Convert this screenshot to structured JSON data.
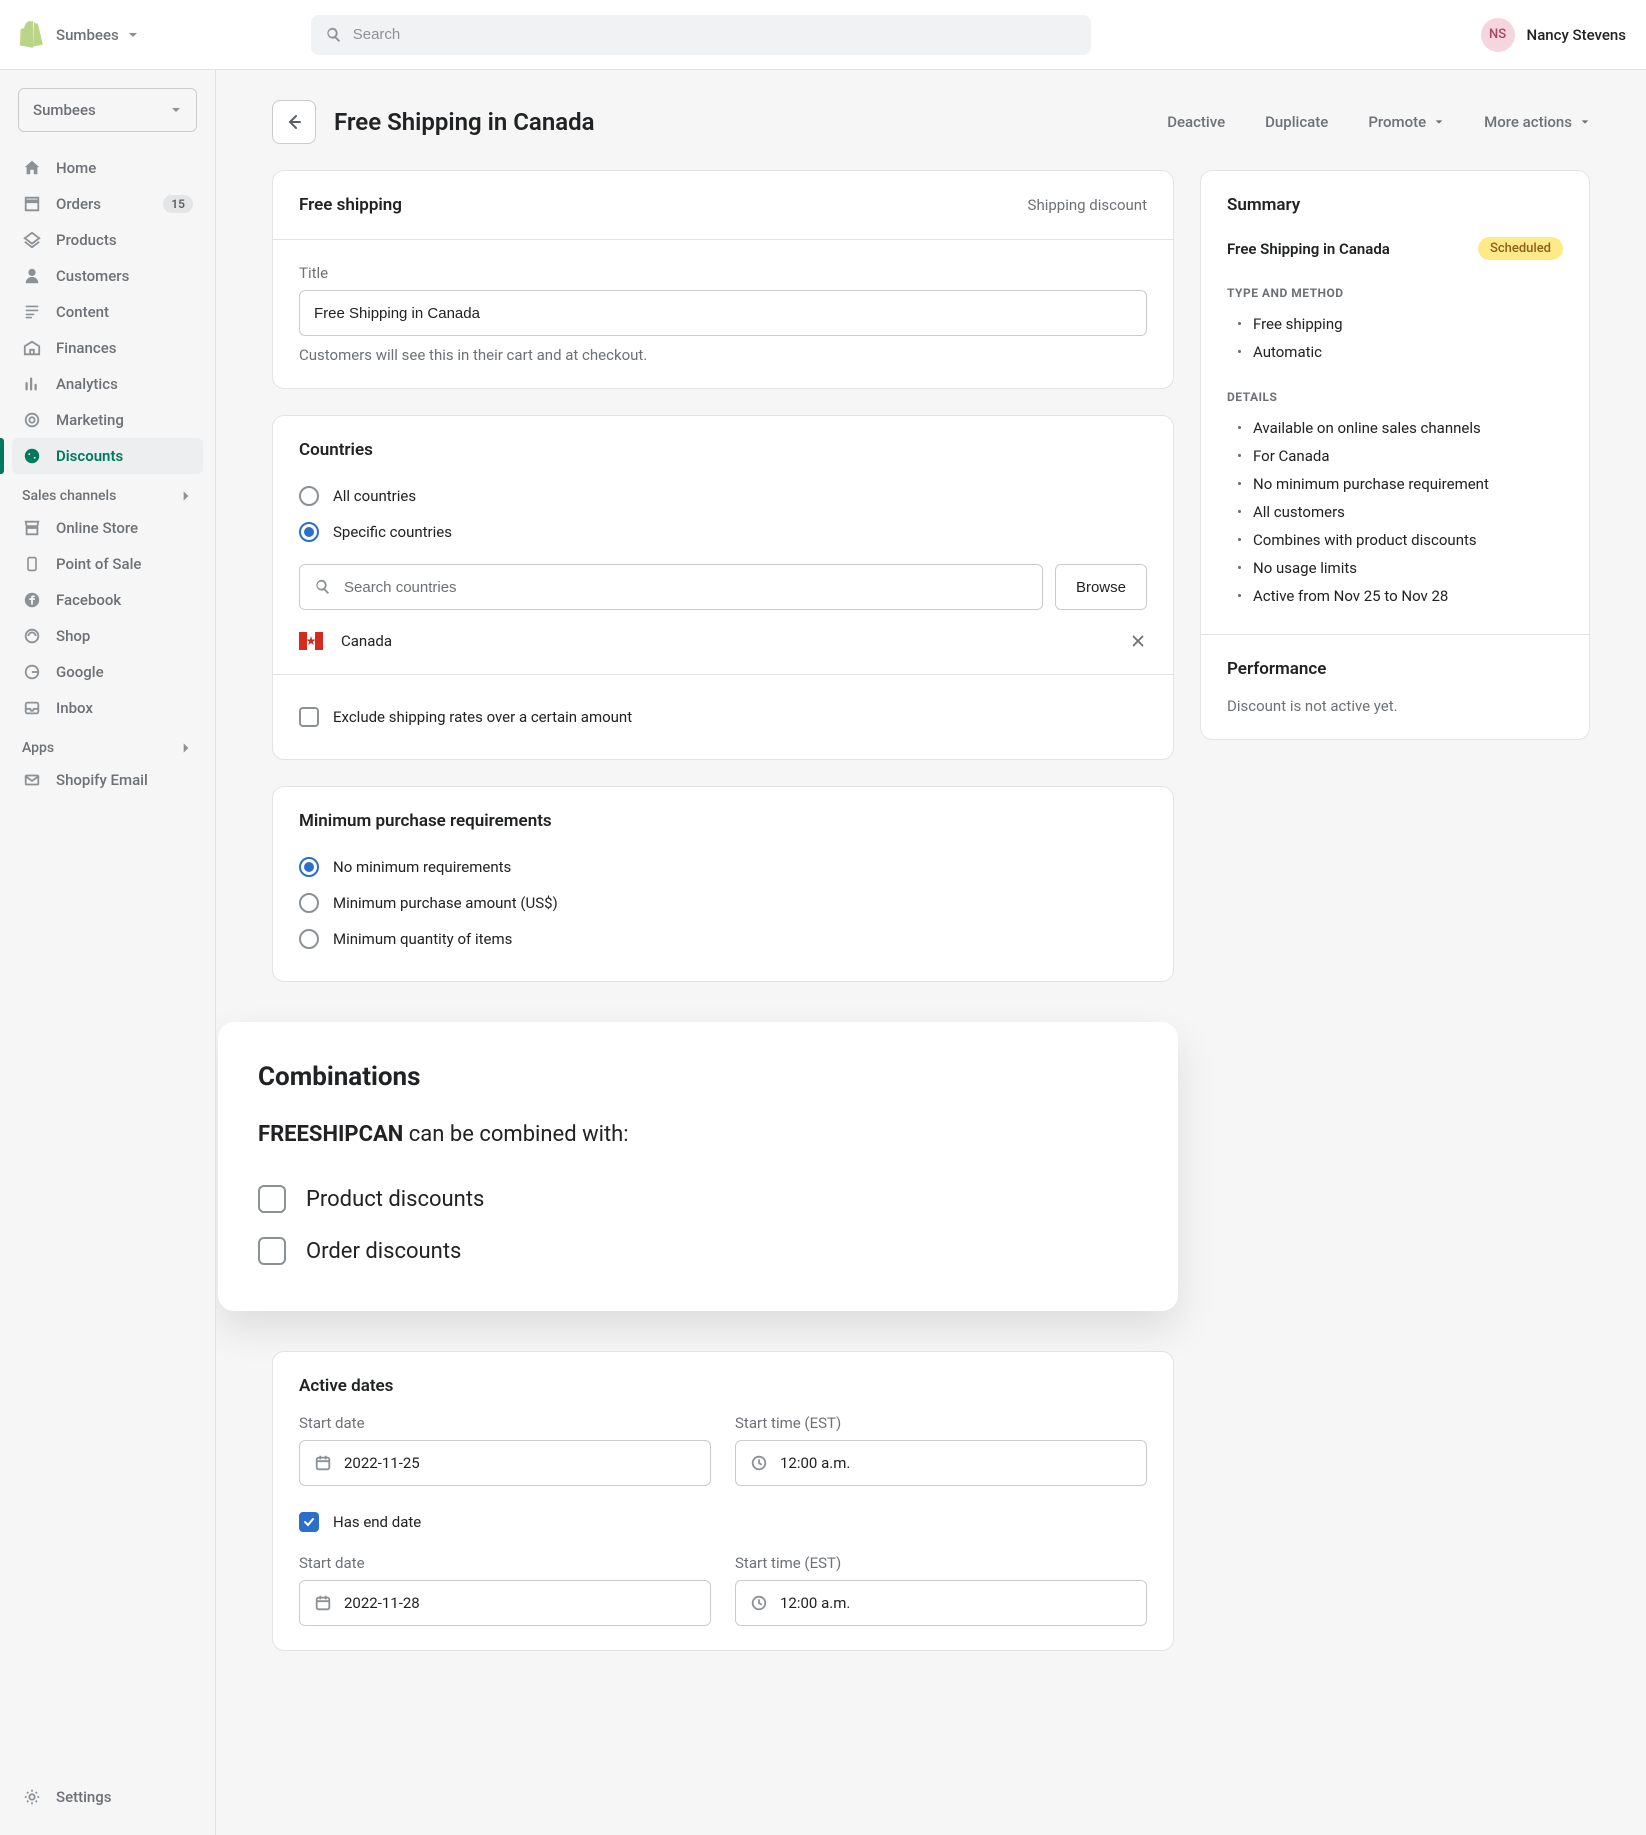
{
  "top": {
    "store_name": "Sumbees",
    "search_placeholder": "Search",
    "user_initials": "NS",
    "user_name": "Nancy Stevens"
  },
  "sidebar": {
    "store_select": "Sumbees",
    "items": [
      {
        "label": "Home",
        "icon": "home"
      },
      {
        "label": "Orders",
        "icon": "orders",
        "badge": "15"
      },
      {
        "label": "Products",
        "icon": "products"
      },
      {
        "label": "Customers",
        "icon": "customers"
      },
      {
        "label": "Content",
        "icon": "content"
      },
      {
        "label": "Finances",
        "icon": "finances"
      },
      {
        "label": "Analytics",
        "icon": "analytics"
      },
      {
        "label": "Marketing",
        "icon": "marketing"
      },
      {
        "label": "Discounts",
        "icon": "discounts",
        "active": true
      }
    ],
    "section_channels": "Sales channels",
    "channels": [
      {
        "label": "Online Store",
        "icon": "store"
      },
      {
        "label": "Point of Sale",
        "icon": "pos"
      },
      {
        "label": "Facebook",
        "icon": "fb"
      },
      {
        "label": "Shop",
        "icon": "shop"
      },
      {
        "label": "Google",
        "icon": "google"
      },
      {
        "label": "Inbox",
        "icon": "inbox"
      }
    ],
    "section_apps": "Apps",
    "apps": [
      {
        "label": "Shopify Email",
        "icon": "email"
      }
    ],
    "settings": "Settings"
  },
  "page": {
    "title": "Free Shipping in Canada",
    "actions": {
      "deactive": "Deactive",
      "duplicate": "Duplicate",
      "promote": "Promote",
      "more": "More actions"
    }
  },
  "free_shipping_card": {
    "title": "Free shipping",
    "sublabel": "Shipping discount",
    "title_label": "Title",
    "title_value": "Free Shipping in Canada",
    "title_help": "Customers will see this in their cart and at checkout."
  },
  "countries_card": {
    "title": "Countries",
    "opt_all": "All countries",
    "opt_specific": "Specific countries",
    "search_placeholder": "Search countries",
    "browse": "Browse",
    "country": "Canada",
    "exclude_label": "Exclude shipping rates over a certain amount"
  },
  "min_req_card": {
    "title": "Minimum purchase requirements",
    "opt_none": "No minimum requirements",
    "opt_amount": "Minimum purchase amount (US$)",
    "opt_qty": "Minimum quantity of items"
  },
  "combos": {
    "title": "Combinations",
    "code": "FREESHIPCAN",
    "subtext": " can be combined with:",
    "opt_product": "Product discounts",
    "opt_order": "Order discounts"
  },
  "dates": {
    "title": "Active dates",
    "start_date_label": "Start date",
    "start_time_label": "Start time (EST)",
    "start_date": "2022-11-25",
    "start_time": "12:00 a.m.",
    "has_end": "Has end date",
    "end_date_label": "Start date",
    "end_time_label": "Start time (EST)",
    "end_date": "2022-11-28",
    "end_time": "12:00 a.m."
  },
  "summary": {
    "title": "Summary",
    "name": "Free Shipping in Canada",
    "status": "Scheduled",
    "heading_type": "TYPE AND METHOD",
    "type_list": [
      "Free shipping",
      "Automatic"
    ],
    "heading_details": "DETAILS",
    "details_list": [
      "Available on online sales channels",
      "For Canada",
      "No minimum purchase requirement",
      "All customers",
      "Combines with product discounts",
      "No usage limits",
      "Active from Nov 25 to Nov 28"
    ],
    "perf_title": "Performance",
    "perf_text": "Discount is not active yet."
  }
}
